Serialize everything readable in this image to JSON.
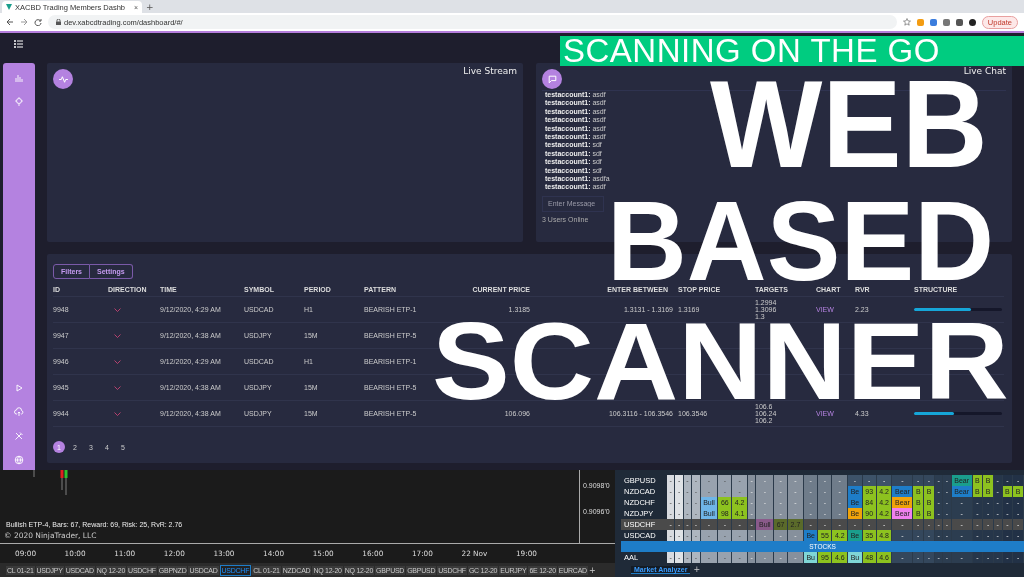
{
  "browser": {
    "tab_title": "XACBD Trading Members Dashb",
    "tab_close": "×",
    "new_tab": "+",
    "url": "dev.xabcdtrading.com/dashboard/#/",
    "update_button": "Update"
  },
  "live_stream": {
    "title": "Live Stream"
  },
  "live_chat": {
    "title": "Live Chat",
    "messages": [
      {
        "text": "**testaccount1:** asdf"
      },
      {
        "text": "**testaccount1:** asdf"
      },
      {
        "text": "**testaccount1:** asdf"
      },
      {
        "text": "**testaccount1:** asdf"
      },
      {
        "text": "**testaccount1:** asdf"
      },
      {
        "text": "**testaccount1:** asdf"
      },
      {
        "text": "**testaccount1:** sdf"
      },
      {
        "text": "**testaccount1:** sdf"
      },
      {
        "text": "**testaccount1:** sdf"
      },
      {
        "text": "**testaccount1:** sdf"
      },
      {
        "text": "**testaccount1:** asdfa"
      },
      {
        "text": "**testaccount1:** asdf"
      }
    ],
    "input": {
      "placeholder": "Enter Message"
    },
    "online": "3 Users Online"
  },
  "scanner": {
    "buttons": [
      {
        "label": "Filters"
      },
      {
        "label": "Settings"
      }
    ],
    "columns": [
      "ID",
      "DIRECTION",
      "TIME",
      "SYMBOL",
      "PERIOD",
      "PATTERN",
      "CURRENT PRICE",
      "ENTER BETWEEN",
      "STOP PRICE",
      "TARGETS",
      "CHART",
      "RVR",
      "STRUCTURE"
    ],
    "rows": [
      {
        "id": "9948",
        "time": "9/12/2020, 4:29 AM",
        "symbol": "USDCAD",
        "period": "H1",
        "pattern": "BEARISH ETP-1",
        "current_price": "1.3185",
        "enter_between": "1.3131 - 1.3169",
        "stop_price": "1.3169",
        "targets": [
          "1.2994",
          "1.3096",
          "1.3"
        ],
        "chart": "VIEW",
        "rvr": "2.23",
        "structure": {
          "level": 0.65
        }
      },
      {
        "id": "9947",
        "time": "9/12/2020, 4:38 AM",
        "symbol": "USDJPY",
        "period": "15M",
        "pattern": "BEARISH ETP-5"
      },
      {
        "id": "9946",
        "time": "9/12/2020, 4:29 AM",
        "symbol": "USDCAD",
        "period": "H1",
        "pattern": "BEARISH ETP-1"
      },
      {
        "id": "9945",
        "time": "9/12/2020, 4:38 AM",
        "symbol": "USDJPY",
        "period": "15M",
        "pattern": "BEARISH ETP-5"
      },
      {
        "id": "9944",
        "time": "9/12/2020, 4:38 AM",
        "symbol": "USDJPY",
        "period": "15M",
        "pattern": "BEARISH ETP-5",
        "current_price": "106.096",
        "enter_between": "106.3116 - 106.3546",
        "stop_price": "106.3546",
        "targets": [
          "106.6",
          "106.24",
          "106.2"
        ],
        "chart": "VIEW",
        "rvr": "4.33",
        "structure": {
          "level": 0.45
        }
      }
    ],
    "pages": [
      {
        "label": "1",
        "selected": true
      },
      {
        "label": "2",
        "selected": false
      },
      {
        "label": "3",
        "selected": false
      },
      {
        "label": "4",
        "selected": false
      },
      {
        "label": "5",
        "selected": false
      }
    ]
  },
  "ninja_chart": {
    "prices": [
      "0.9098'0",
      "0.9096'0"
    ],
    "annotation": "Bullish ETP-4, Bars: 67, Reward: 69, Risk: 25, RvR: 2.76",
    "copyright": "© 2020 NinjaTrader, LLC",
    "times": [
      "09:00",
      "10:00",
      "11:00",
      "12:00",
      "13:00",
      "14:00",
      "15:00",
      "16:00",
      "17:00",
      "22 Nov",
      "19:00"
    ],
    "tabs": [
      {
        "label": "CL 01-21",
        "selected": false
      },
      {
        "label": "USDJPY",
        "selected": false
      },
      {
        "label": "USDCAD",
        "selected": false
      },
      {
        "label": "NQ 12-20",
        "selected": false
      },
      {
        "label": "USDCHF",
        "selected": false
      },
      {
        "label": "GBPNZD",
        "selected": false
      },
      {
        "label": "USDCAD",
        "selected": false
      },
      {
        "label": "USDCHF",
        "selected": true
      },
      {
        "label": "CL 01-21",
        "selected": false
      },
      {
        "label": "NZDCAD",
        "selected": false
      },
      {
        "label": "NQ 12-20",
        "selected": false
      },
      {
        "label": "NQ 12-20",
        "selected": false
      },
      {
        "label": "GBPUSD",
        "selected": false
      },
      {
        "label": "GBPUSD",
        "selected": false
      },
      {
        "label": "USDCHF",
        "selected": false
      },
      {
        "label": "GC 12-20",
        "selected": false
      },
      {
        "label": "EURJPY",
        "selected": false
      },
      {
        "label": "6E 12-20",
        "selected": false
      },
      {
        "label": "EURCAD",
        "selected": false
      }
    ],
    "add_tab": "+"
  },
  "market_analyzer": {
    "rows": [
      {
        "kind": "row",
        "symbol": "GBPUSD",
        "cells": [
          {
            "text": "-"
          },
          {
            "text": "-"
          },
          {
            "text": "-"
          },
          {
            "text": "-"
          },
          {
            "text": "-"
          },
          {
            "text": "-"
          },
          {
            "text": "-"
          },
          {
            "text": "-"
          },
          {
            "text": "-"
          },
          {
            "text": "-"
          },
          {
            "text": "-"
          },
          {
            "text": "-"
          },
          {
            "text": "-"
          },
          {
            "text": "-"
          },
          {
            "text": "-"
          },
          {
            "text": "-"
          },
          {
            "text": "-"
          },
          {
            "text": "-"
          },
          {
            "text": "-"
          },
          {
            "text": "-"
          },
          {
            "text": "-"
          },
          {
            "text": "-"
          },
          {
            "text": "Bear",
            "color": "#1a9e8c"
          },
          {
            "text": "B",
            "color": "#8dc21f"
          },
          {
            "text": "B",
            "color": "#8dc21f"
          },
          {
            "text": "-"
          },
          {
            "text": "-"
          },
          {
            "text": "-"
          }
        ]
      },
      {
        "kind": "row",
        "symbol": "NZDCAD",
        "cells": [
          {
            "text": "-"
          },
          {
            "text": "-"
          },
          {
            "text": "-"
          },
          {
            "text": "-"
          },
          {
            "text": "-"
          },
          {
            "text": "-"
          },
          {
            "text": "-"
          },
          {
            "text": "-"
          },
          {
            "text": "-"
          },
          {
            "text": "-"
          },
          {
            "text": "-"
          },
          {
            "text": "-"
          },
          {
            "text": "-"
          },
          {
            "text": "-"
          },
          {
            "text": "Be",
            "color": "#1e7dc8"
          },
          {
            "text": "93",
            "color": "#8dc21f"
          },
          {
            "text": "4.2",
            "color": "#8dc21f"
          },
          {
            "text": "Bear",
            "color": "#1e7dc8"
          },
          {
            "text": "B",
            "color": "#8dc21f"
          },
          {
            "text": "B",
            "color": "#8dc21f"
          },
          {
            "text": "-"
          },
          {
            "text": "-"
          },
          {
            "text": "Bear",
            "color": "#1e7dc8"
          },
          {
            "text": "B",
            "color": "#8dc21f"
          },
          {
            "text": "B",
            "color": "#8dc21f"
          },
          {
            "text": "-"
          },
          {
            "text": "B",
            "color": "#8dc21f"
          },
          {
            "text": "B",
            "color": "#8dc21f"
          }
        ]
      },
      {
        "kind": "row",
        "symbol": "NZDCHF",
        "cells": [
          {
            "text": "-"
          },
          {
            "text": "-"
          },
          {
            "text": "-"
          },
          {
            "text": "-"
          },
          {
            "text": "Bull",
            "color": "#6fb5e8"
          },
          {
            "text": "66",
            "color": "#8dc21f"
          },
          {
            "text": "4.2",
            "color": "#8dc21f"
          },
          {
            "text": "-"
          },
          {
            "text": "-"
          },
          {
            "text": "-"
          },
          {
            "text": "-"
          },
          {
            "text": "-"
          },
          {
            "text": "-"
          },
          {
            "text": "-"
          },
          {
            "text": "Be",
            "color": "#1e7dc8"
          },
          {
            "text": "84",
            "color": "#8dc21f"
          },
          {
            "text": "4.2",
            "color": "#8dc21f"
          },
          {
            "text": "Bear",
            "color": "#f0a30a"
          },
          {
            "text": "B",
            "color": "#8dc21f"
          },
          {
            "text": "B",
            "color": "#8dc21f"
          },
          {
            "text": "-"
          },
          {
            "text": "-"
          },
          {
            "text": "-"
          },
          {
            "text": "-"
          },
          {
            "text": "-"
          },
          {
            "text": "-"
          },
          {
            "text": "-"
          },
          {
            "text": "-"
          }
        ]
      },
      {
        "kind": "row",
        "symbol": "NZDJPY",
        "cells": [
          {
            "text": "-"
          },
          {
            "text": "-"
          },
          {
            "text": "-"
          },
          {
            "text": "-"
          },
          {
            "text": "Bull",
            "color": "#6fb5e8"
          },
          {
            "text": "98",
            "color": "#8dc21f"
          },
          {
            "text": "4.1",
            "color": "#8dc21f"
          },
          {
            "text": "-"
          },
          {
            "text": "-"
          },
          {
            "text": "-"
          },
          {
            "text": "-"
          },
          {
            "text": "-"
          },
          {
            "text": "-"
          },
          {
            "text": "-"
          },
          {
            "text": "Be",
            "color": "#f0a30a"
          },
          {
            "text": "90",
            "color": "#8dc21f"
          },
          {
            "text": "4.2",
            "color": "#8dc21f"
          },
          {
            "text": "Bear",
            "color": "#f080f0"
          },
          {
            "text": "B",
            "color": "#8dc21f"
          },
          {
            "text": "B",
            "color": "#8dc21f"
          },
          {
            "text": "-"
          },
          {
            "text": "-"
          },
          {
            "text": "-"
          },
          {
            "text": "-"
          },
          {
            "text": "-"
          },
          {
            "text": "-"
          },
          {
            "text": "-"
          },
          {
            "text": "-"
          }
        ]
      },
      {
        "kind": "row",
        "symbol": "USDCHF",
        "selected": true,
        "cells": [
          {
            "text": "-"
          },
          {
            "text": "-"
          },
          {
            "text": "-"
          },
          {
            "text": "-"
          },
          {
            "text": "-"
          },
          {
            "text": "-"
          },
          {
            "text": "-"
          },
          {
            "text": "-"
          },
          {
            "text": "Bull",
            "color": "#8a5a8a"
          },
          {
            "text": "67",
            "color": "#5a6a2a"
          },
          {
            "text": "2.7",
            "color": "#5a6a2a"
          },
          {
            "text": "-"
          },
          {
            "text": "-"
          },
          {
            "text": "-"
          },
          {
            "text": "-"
          },
          {
            "text": "-"
          },
          {
            "text": "-"
          },
          {
            "text": "-"
          },
          {
            "text": "-"
          },
          {
            "text": "-"
          },
          {
            "text": "-"
          },
          {
            "text": "-"
          },
          {
            "text": "-"
          },
          {
            "text": "-"
          },
          {
            "text": "-"
          },
          {
            "text": "-"
          },
          {
            "text": "-"
          },
          {
            "text": "-"
          }
        ]
      },
      {
        "kind": "row",
        "symbol": "USDCAD",
        "selected": false,
        "cells": [
          {
            "text": "-"
          },
          {
            "text": "-"
          },
          {
            "text": "-"
          },
          {
            "text": "-"
          },
          {
            "text": "-"
          },
          {
            "text": "-"
          },
          {
            "text": "-"
          },
          {
            "text": "-"
          },
          {
            "text": "-"
          },
          {
            "text": "-"
          },
          {
            "text": "-"
          },
          {
            "text": "Be",
            "color": "#1e7dc8"
          },
          {
            "text": "55",
            "color": "#8dc21f"
          },
          {
            "text": "4.2",
            "color": "#8dc21f"
          },
          {
            "text": "Be",
            "color": "#1a9e8c"
          },
          {
            "text": "35",
            "color": "#8dc21f"
          },
          {
            "text": "4.8",
            "color": "#8dc21f"
          },
          {
            "text": "-"
          },
          {
            "text": "-"
          },
          {
            "text": "-"
          },
          {
            "text": "-"
          },
          {
            "text": "-"
          },
          {
            "text": "-"
          },
          {
            "text": "-"
          },
          {
            "text": "-"
          },
          {
            "text": "-"
          },
          {
            "text": "-"
          },
          {
            "text": "-"
          }
        ]
      },
      {
        "kind": "group",
        "symbol": "STOCKS"
      },
      {
        "kind": "row",
        "symbol": "AAL",
        "cells": [
          {
            "text": "-"
          },
          {
            "text": "-"
          },
          {
            "text": "-"
          },
          {
            "text": "-"
          },
          {
            "text": "-"
          },
          {
            "text": "-"
          },
          {
            "text": "-"
          },
          {
            "text": "-"
          },
          {
            "text": "-"
          },
          {
            "text": "-"
          },
          {
            "text": "-"
          },
          {
            "text": "Bu",
            "color": "#7fd6d6"
          },
          {
            "text": "95",
            "color": "#8dc21f"
          },
          {
            "text": "4.6",
            "color": "#8dc21f"
          },
          {
            "text": "Bu",
            "color": "#7fd6d6"
          },
          {
            "text": "48",
            "color": "#8dc21f"
          },
          {
            "text": "4.6",
            "color": "#8dc21f"
          },
          {
            "text": "-"
          },
          {
            "text": "-"
          },
          {
            "text": "-"
          },
          {
            "text": "-"
          },
          {
            "text": "-"
          },
          {
            "text": "-"
          },
          {
            "text": "-"
          },
          {
            "text": "-"
          },
          {
            "text": "-"
          },
          {
            "text": "-"
          },
          {
            "text": "-"
          }
        ]
      }
    ],
    "tabs": [
      {
        "label": "Market Analyzer",
        "selected": true
      }
    ],
    "add_tab": "+"
  },
  "overlay": {
    "banner": "SCANNING ON THE GO",
    "lines": [
      "WEB",
      "BASED",
      "SCANNER"
    ]
  }
}
